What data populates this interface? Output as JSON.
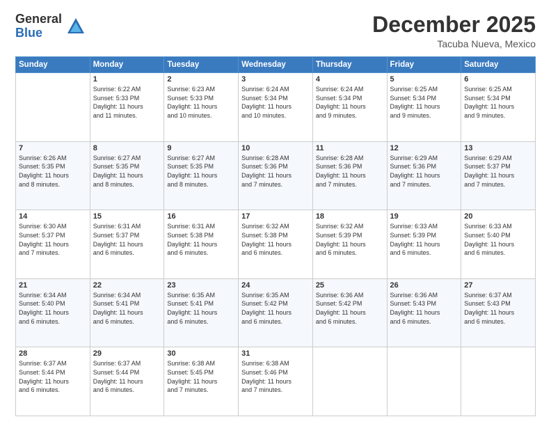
{
  "logo": {
    "general": "General",
    "blue": "Blue"
  },
  "header": {
    "month": "December 2025",
    "location": "Tacuba Nueva, Mexico"
  },
  "weekdays": [
    "Sunday",
    "Monday",
    "Tuesday",
    "Wednesday",
    "Thursday",
    "Friday",
    "Saturday"
  ],
  "weeks": [
    [
      {
        "day": "",
        "info": ""
      },
      {
        "day": "1",
        "info": "Sunrise: 6:22 AM\nSunset: 5:33 PM\nDaylight: 11 hours\nand 11 minutes."
      },
      {
        "day": "2",
        "info": "Sunrise: 6:23 AM\nSunset: 5:33 PM\nDaylight: 11 hours\nand 10 minutes."
      },
      {
        "day": "3",
        "info": "Sunrise: 6:24 AM\nSunset: 5:34 PM\nDaylight: 11 hours\nand 10 minutes."
      },
      {
        "day": "4",
        "info": "Sunrise: 6:24 AM\nSunset: 5:34 PM\nDaylight: 11 hours\nand 9 minutes."
      },
      {
        "day": "5",
        "info": "Sunrise: 6:25 AM\nSunset: 5:34 PM\nDaylight: 11 hours\nand 9 minutes."
      },
      {
        "day": "6",
        "info": "Sunrise: 6:25 AM\nSunset: 5:34 PM\nDaylight: 11 hours\nand 9 minutes."
      }
    ],
    [
      {
        "day": "7",
        "info": "Sunrise: 6:26 AM\nSunset: 5:35 PM\nDaylight: 11 hours\nand 8 minutes."
      },
      {
        "day": "8",
        "info": "Sunrise: 6:27 AM\nSunset: 5:35 PM\nDaylight: 11 hours\nand 8 minutes."
      },
      {
        "day": "9",
        "info": "Sunrise: 6:27 AM\nSunset: 5:35 PM\nDaylight: 11 hours\nand 8 minutes."
      },
      {
        "day": "10",
        "info": "Sunrise: 6:28 AM\nSunset: 5:36 PM\nDaylight: 11 hours\nand 7 minutes."
      },
      {
        "day": "11",
        "info": "Sunrise: 6:28 AM\nSunset: 5:36 PM\nDaylight: 11 hours\nand 7 minutes."
      },
      {
        "day": "12",
        "info": "Sunrise: 6:29 AM\nSunset: 5:36 PM\nDaylight: 11 hours\nand 7 minutes."
      },
      {
        "day": "13",
        "info": "Sunrise: 6:29 AM\nSunset: 5:37 PM\nDaylight: 11 hours\nand 7 minutes."
      }
    ],
    [
      {
        "day": "14",
        "info": "Sunrise: 6:30 AM\nSunset: 5:37 PM\nDaylight: 11 hours\nand 7 minutes."
      },
      {
        "day": "15",
        "info": "Sunrise: 6:31 AM\nSunset: 5:37 PM\nDaylight: 11 hours\nand 6 minutes."
      },
      {
        "day": "16",
        "info": "Sunrise: 6:31 AM\nSunset: 5:38 PM\nDaylight: 11 hours\nand 6 minutes."
      },
      {
        "day": "17",
        "info": "Sunrise: 6:32 AM\nSunset: 5:38 PM\nDaylight: 11 hours\nand 6 minutes."
      },
      {
        "day": "18",
        "info": "Sunrise: 6:32 AM\nSunset: 5:39 PM\nDaylight: 11 hours\nand 6 minutes."
      },
      {
        "day": "19",
        "info": "Sunrise: 6:33 AM\nSunset: 5:39 PM\nDaylight: 11 hours\nand 6 minutes."
      },
      {
        "day": "20",
        "info": "Sunrise: 6:33 AM\nSunset: 5:40 PM\nDaylight: 11 hours\nand 6 minutes."
      }
    ],
    [
      {
        "day": "21",
        "info": "Sunrise: 6:34 AM\nSunset: 5:40 PM\nDaylight: 11 hours\nand 6 minutes."
      },
      {
        "day": "22",
        "info": "Sunrise: 6:34 AM\nSunset: 5:41 PM\nDaylight: 11 hours\nand 6 minutes."
      },
      {
        "day": "23",
        "info": "Sunrise: 6:35 AM\nSunset: 5:41 PM\nDaylight: 11 hours\nand 6 minutes."
      },
      {
        "day": "24",
        "info": "Sunrise: 6:35 AM\nSunset: 5:42 PM\nDaylight: 11 hours\nand 6 minutes."
      },
      {
        "day": "25",
        "info": "Sunrise: 6:36 AM\nSunset: 5:42 PM\nDaylight: 11 hours\nand 6 minutes."
      },
      {
        "day": "26",
        "info": "Sunrise: 6:36 AM\nSunset: 5:43 PM\nDaylight: 11 hours\nand 6 minutes."
      },
      {
        "day": "27",
        "info": "Sunrise: 6:37 AM\nSunset: 5:43 PM\nDaylight: 11 hours\nand 6 minutes."
      }
    ],
    [
      {
        "day": "28",
        "info": "Sunrise: 6:37 AM\nSunset: 5:44 PM\nDaylight: 11 hours\nand 6 minutes."
      },
      {
        "day": "29",
        "info": "Sunrise: 6:37 AM\nSunset: 5:44 PM\nDaylight: 11 hours\nand 6 minutes."
      },
      {
        "day": "30",
        "info": "Sunrise: 6:38 AM\nSunset: 5:45 PM\nDaylight: 11 hours\nand 7 minutes."
      },
      {
        "day": "31",
        "info": "Sunrise: 6:38 AM\nSunset: 5:46 PM\nDaylight: 11 hours\nand 7 minutes."
      },
      {
        "day": "",
        "info": ""
      },
      {
        "day": "",
        "info": ""
      },
      {
        "day": "",
        "info": ""
      }
    ]
  ]
}
